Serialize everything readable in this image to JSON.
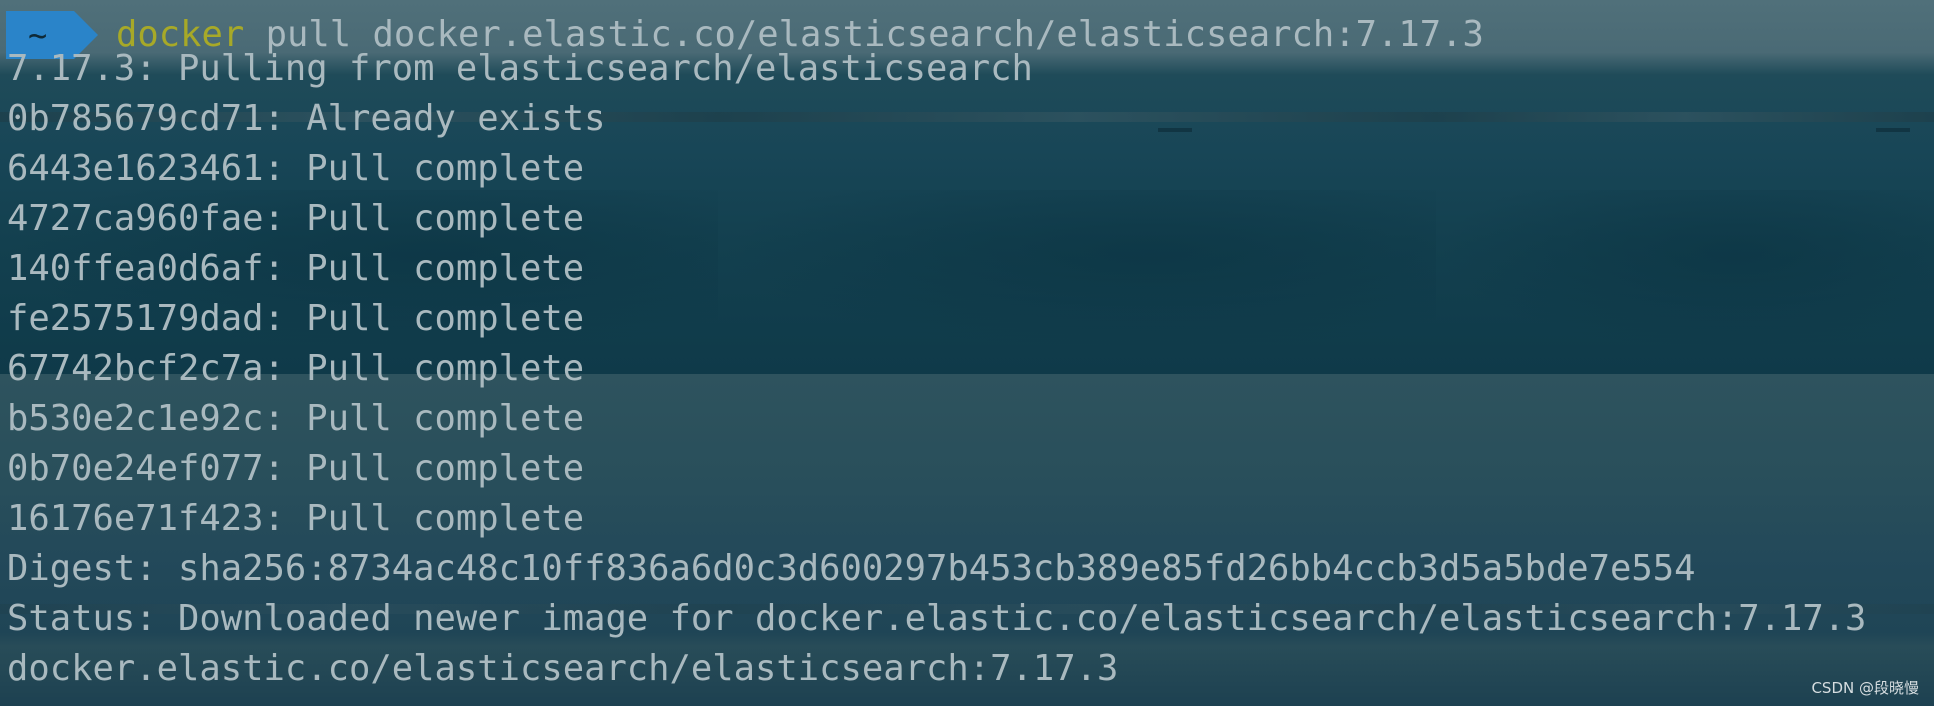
{
  "terminal": {
    "prompt_symbol": "~",
    "command": {
      "program": "docker",
      "args": " pull docker.elastic.co/elasticsearch/elasticsearch:7.17.3"
    },
    "output": [
      "7.17.3: Pulling from elasticsearch/elasticsearch",
      "0b785679cd71: Already exists",
      "6443e1623461: Pull complete",
      "4727ca960fae: Pull complete",
      "140ffea0d6af: Pull complete",
      "fe2575179dad: Pull complete",
      "67742bcf2c7a: Pull complete",
      "b530e2c1e92c: Pull complete",
      "0b70e24ef077: Pull complete",
      "16176e71f423: Pull complete",
      "Digest: sha256:8734ac48c10ff836a6d0c3d600297b453cb389e85fd26bb4ccb3d5a5bde7e554",
      "Status: Downloaded newer image for docker.elastic.co/elasticsearch/elasticsearch:7.17.3",
      "docker.elastic.co/elasticsearch/elasticsearch:7.17.3"
    ]
  },
  "watermark": "CSDN @段晓慢",
  "colors": {
    "prompt_bg": "#2a84c9",
    "command_name": "#a7a928",
    "output_text": "#a9b9bf"
  }
}
